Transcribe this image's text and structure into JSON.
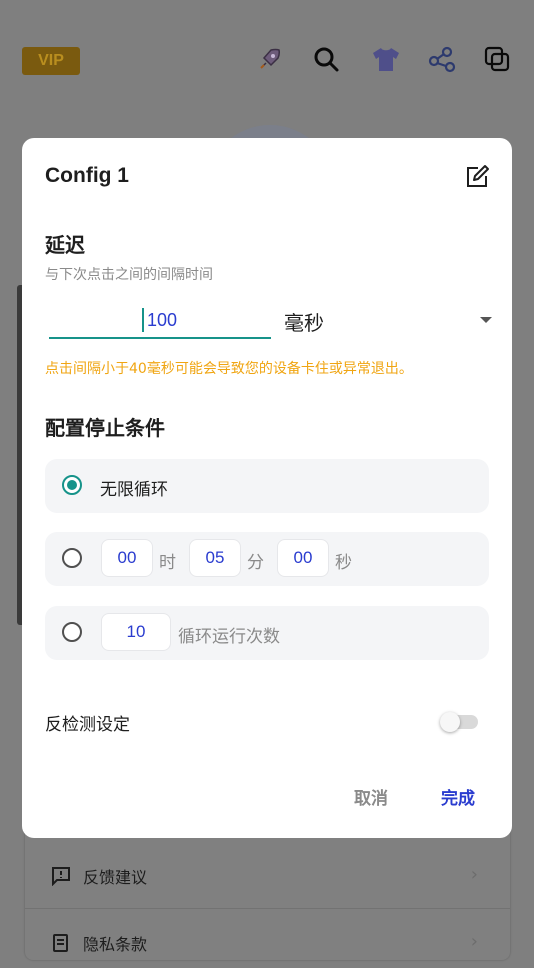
{
  "background": {
    "vip_label": "VIP",
    "top_icons": [
      "rocket-icon",
      "search-icon",
      "shirt-icon",
      "share-icon",
      "copy-icon"
    ],
    "menu": [
      {
        "icon": "feedback-icon",
        "label": "反馈建议"
      },
      {
        "icon": "document-icon",
        "label": "隐私条款"
      }
    ]
  },
  "dialog": {
    "title": "Config 1",
    "delay": {
      "heading": "延迟",
      "description": "与下次点击之间的间隔时间",
      "value": "100",
      "unit": "毫秒",
      "warning": "点击间隔小于40毫秒可能会导致您的设备卡住或异常退出。"
    },
    "stop": {
      "heading": "配置停止条件",
      "infinite_label": "无限循环",
      "timer": {
        "hours": "00",
        "hours_unit": "时",
        "minutes": "05",
        "minutes_unit": "分",
        "seconds": "00",
        "seconds_unit": "秒"
      },
      "count": {
        "value": "10",
        "label": "循环运行次数"
      },
      "selected": "infinite"
    },
    "anti_detect_label": "反检测设定",
    "anti_detect_enabled": false,
    "cancel_label": "取消",
    "done_label": "完成"
  },
  "colors": {
    "accent_teal": "#16938a",
    "accent_blue": "#2a3ccf",
    "warning_orange": "#f0a512"
  }
}
